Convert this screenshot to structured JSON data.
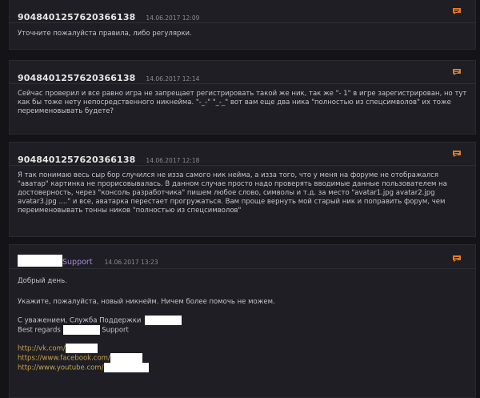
{
  "posts": [
    {
      "author": "904840125762036613​8",
      "date": "14.06.2017 12:09",
      "text": "Уточните пожалуйста правила, либо регулярки."
    },
    {
      "author": "904840125762036613​8",
      "date": "14.06.2017 12:14",
      "text": "Сейчас проверил и все равно игра не запрещает регистрировать такой же ник, так же \"- 1\" в игре зарегистрирован, но тут как бы тоже нету непосредственного никнейма. \"-_-\" \"_-_\" вот вам еще два ника \"полностью из спецсимволов\" их тоже переименовывать будете?"
    },
    {
      "author": "904840125762036613​8",
      "date": "14.06.2017 12:18",
      "text": "Я так понимаю весь сыр бор случился не изза самого ник нейма, а изза того, что у меня на форуме не отображался \"аватар\" картинка не прорисовывалась. В данном случае просто надо проверять вводимые данные пользователем на достоверность, через \"консоль разработчика\" пишем любое слово, символы и т.д. за место \"avatar1.jpg avatar2.jpg avatar3.jpg ....\" и все, аватарка перестает прогружаться. Вам проще вернуть мой старый ник и поправить форум, чем переименовывать тонны ников \"полностью из спецсимволов\""
    }
  ],
  "support_post": {
    "author": "Support",
    "date": "14.06.2017 13:23",
    "greeting": "Добрый день.",
    "message": "Укажите, пожалуйста, новый никнейм. Ничем более помочь не можем.",
    "regards_line": "С уважением, Служба Поддержки",
    "best_regards": "Best regards",
    "support_word": "Support",
    "links": [
      "http://vk.com/",
      "https://www.facebook.com/",
      "http://www.youtube.com/"
    ]
  },
  "colors": {
    "background": "#141418",
    "post_bg": "#1e1e24",
    "support_name": "#a78be0",
    "link": "#c7a34a",
    "quote_icon": "#e07a1f"
  },
  "icons": {
    "quote": "quote-icon"
  }
}
